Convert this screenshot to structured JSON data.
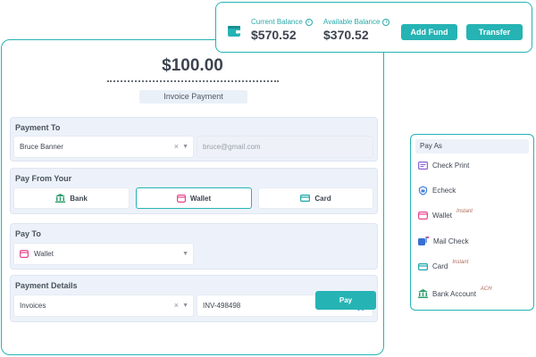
{
  "balance": {
    "current_label": "Current Balance",
    "current_value": "$570.52",
    "available_label": "Available Balance",
    "available_value": "$370.52",
    "add_fund_label": "Add Fund",
    "transfer_label": "Transfer"
  },
  "payment": {
    "amount": "$100.00",
    "type_badge": "Invoice Payment"
  },
  "payment_to": {
    "title": "Payment To",
    "recipient": "Bruce Banner",
    "email_placeholder": "bruce@gmail.com"
  },
  "pay_from": {
    "title": "Pay From Your",
    "options": [
      "Bank",
      "Wallet",
      "Card"
    ],
    "selected": "Wallet"
  },
  "pay_to": {
    "title": "Pay To",
    "method": "Wallet"
  },
  "payment_details": {
    "title": "Payment Details",
    "type": "Invoices",
    "invoice_number": "INV-498498"
  },
  "pay_button_label": "Pay",
  "pay_as": {
    "title": "Pay As",
    "items": [
      {
        "label": "Check Print",
        "badge": "",
        "icon": "check-print-icon"
      },
      {
        "label": "Echeck",
        "badge": "",
        "icon": "echeck-icon"
      },
      {
        "label": "Wallet",
        "badge": "Instant",
        "icon": "wallet-icon"
      },
      {
        "label": "Mail Check",
        "badge": "",
        "icon": "mail-check-icon"
      },
      {
        "label": "Card",
        "badge": "Instant",
        "icon": "card-icon"
      },
      {
        "label": "Bank Account",
        "badge": "ACH",
        "icon": "bank-icon"
      }
    ]
  },
  "colors": {
    "accent": "#26b3b4",
    "section_bg": "#edf2fa",
    "wallet_pink": "#e8468f",
    "card_teal": "#1fa6a8",
    "check_purple": "#8a63d2",
    "echeck_blue": "#3f7fd9",
    "mail_blue": "#3a6fd0",
    "bank_green": "#2f9e6e"
  }
}
